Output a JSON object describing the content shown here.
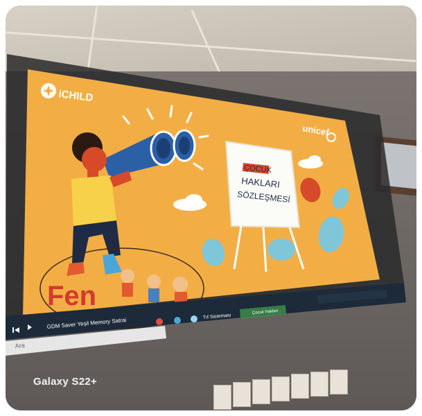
{
  "photo": {
    "device_caption": "Galaxy S22+",
    "colors": {
      "slide_bg": "#f2a93a",
      "ceiling": "#cfc8bc",
      "wall": "#6f6865",
      "taskbar": "#1c2a3a"
    }
  },
  "slide": {
    "brand_logo_text": "iCHILD",
    "partner_logo_text": "unicef",
    "board_title_line1": "ÇOCUK",
    "board_title_line2": "HAKLARI",
    "board_title_line3": "SÖZLEŞMESİ",
    "watermark_text": "Fen"
  },
  "taskbar": {
    "search_placeholder": "Ara",
    "media_title": "GDM Saver Yeşil Memory Satrai",
    "window_item_1": "Tıf Sisteması",
    "window_item_2": "Çocuk Hakları"
  }
}
